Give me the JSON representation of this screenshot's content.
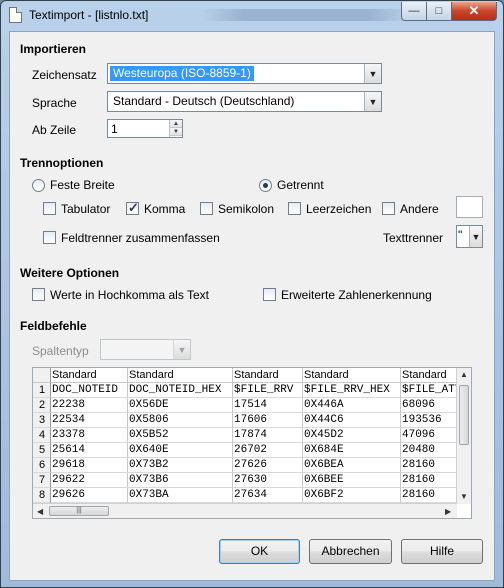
{
  "window": {
    "title": "Textimport - [listnlo.txt]",
    "minimize_glyph": "—",
    "maximize_glyph": "□",
    "close_glyph": "✕"
  },
  "import": {
    "section": "Importieren",
    "charset_label": "Zeichensatz",
    "charset_value": "Westeuropa (ISO-8859-1)",
    "language_label": "Sprache",
    "language_value": "Standard - Deutsch (Deutschland)",
    "from_row_label": "Ab Zeile",
    "from_row_value": "1"
  },
  "separator": {
    "section": "Trennoptionen",
    "fixed_width": "Feste Breite",
    "separated": "Getrennt",
    "tab": "Tabulator",
    "comma": "Komma",
    "semicolon": "Semikolon",
    "space": "Leerzeichen",
    "other": "Andere",
    "merge": "Feldtrenner zusammenfassen",
    "text_delimiter_label": "Texttrenner",
    "text_delimiter_value": "\"",
    "checked": {
      "tab": false,
      "comma": true,
      "semicolon": false,
      "space": false,
      "other": false,
      "merge": false
    },
    "mode": "separated"
  },
  "more": {
    "section": "Weitere Optionen",
    "quoted_as_text": "Werte in Hochkomma als Text",
    "detect_numbers": "Erweiterte Zahlenerkennung"
  },
  "fields": {
    "section": "Feldbefehle",
    "column_type_label": "Spaltentyp",
    "column_type_value": ""
  },
  "grid": {
    "headers": [
      "Standard",
      "Standard",
      "Standard",
      "Standard",
      "Standard"
    ],
    "rows": [
      [
        "1",
        "DOC_NOTEID",
        "DOC_NOTEID_HEX",
        "$FILE_RRV",
        "$FILE_RRV_HEX",
        "$FILE_ATTA"
      ],
      [
        "2",
        "22238",
        "0X56DE",
        "17514",
        "0X446A",
        "68096"
      ],
      [
        "3",
        "22534",
        "0X5806",
        "17606",
        "0X44C6",
        "193536"
      ],
      [
        "4",
        "23378",
        "0X5B52",
        "17874",
        "0X45D2",
        "47096"
      ],
      [
        "5",
        "25614",
        "0X640E",
        "26702",
        "0X684E",
        "20480"
      ],
      [
        "6",
        "29618",
        "0X73B2",
        "27626",
        "0X6BEA",
        "28160"
      ],
      [
        "7",
        "29622",
        "0X73B6",
        "27630",
        "0X6BEE",
        "28160"
      ],
      [
        "8",
        "29626",
        "0X73BA",
        "27634",
        "0X6BF2",
        "28160"
      ]
    ]
  },
  "buttons": {
    "ok": "OK",
    "cancel": "Abbrechen",
    "help": "Hilfe"
  }
}
